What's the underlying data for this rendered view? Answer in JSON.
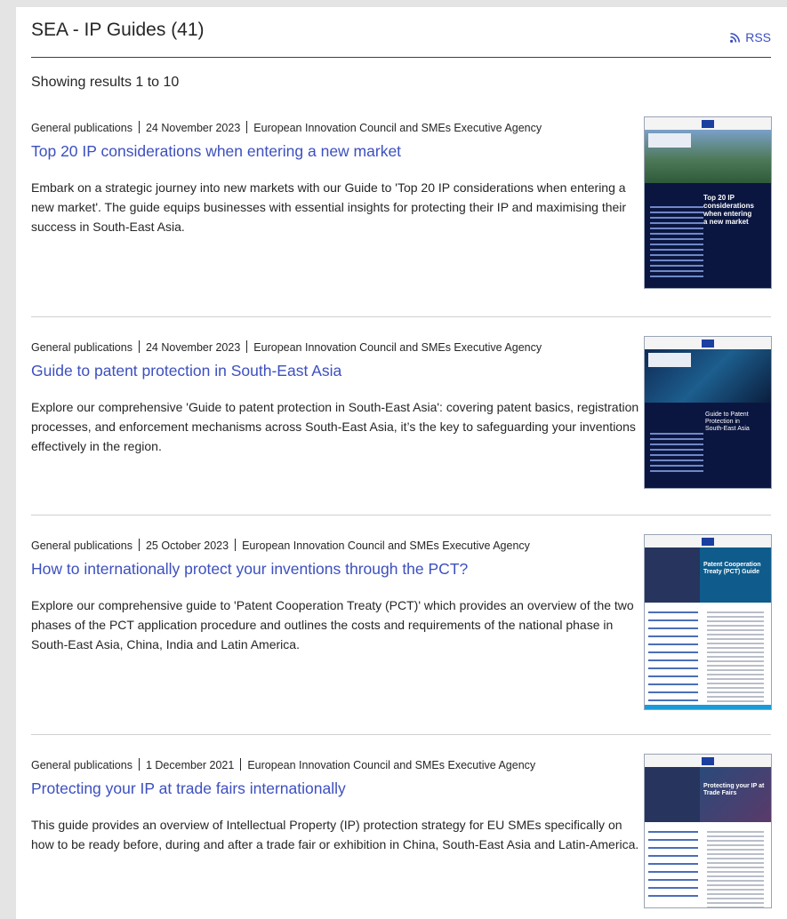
{
  "header": {
    "title": "SEA - IP Guides (41)",
    "rss_label": "RSS"
  },
  "results": {
    "summary": "Showing results 1 to 10"
  },
  "items": [
    {
      "type": "General publications",
      "date": "24 November 2023",
      "author": "European Innovation Council and SMEs Executive Agency",
      "title": "Top 20 IP considerations when entering a new market",
      "description": "Embark on a strategic journey into new markets with our Guide to 'Top 20 IP considerations when entering a new market'. The guide equips businesses with essential insights for protecting their IP and maximising their success in South-East Asia.",
      "cover_heading": "Top 20 IP considerations when entering a new market"
    },
    {
      "type": "General publications",
      "date": "24 November 2023",
      "author": "European Innovation Council and SMEs Executive Agency",
      "title": "Guide to patent protection in South-East Asia",
      "description": "Explore our comprehensive 'Guide to patent protection in South-East Asia': covering patent basics, registration processes, and enforcement mechanisms across South-East Asia, it’s the key to safeguarding your inventions effectively in the region.",
      "cover_heading": "Guide to Patent Protection in South-East Asia"
    },
    {
      "type": "General publications",
      "date": "25 October 2023",
      "author": "European Innovation Council and SMEs Executive Agency",
      "title": "How to internationally protect your inventions through the PCT?",
      "description": "Explore our comprehensive guide to 'Patent Cooperation Treaty (PCT)' which provides an overview of the two phases of the PCT application procedure and outlines the costs and requirements of the national phase in South-East Asia, China, India and Latin America.",
      "cover_heading": "Patent Cooperation Treaty (PCT) Guide"
    },
    {
      "type": "General publications",
      "date": "1 December 2021",
      "author": "European Innovation Council and SMEs Executive Agency",
      "title": "Protecting your IP at trade fairs internationally",
      "description": "This guide provides an overview of Intellectual Property (IP) protection strategy for EU SMEs specifically on how to be ready before, during and after a trade fair or exhibition in China, South-East Asia and Latin-America.",
      "cover_heading": "Protecting your IP at Trade Fairs"
    }
  ],
  "colors": {
    "link": "#3c4fc0",
    "text": "#262626",
    "page_background": "#e4e4e4"
  }
}
